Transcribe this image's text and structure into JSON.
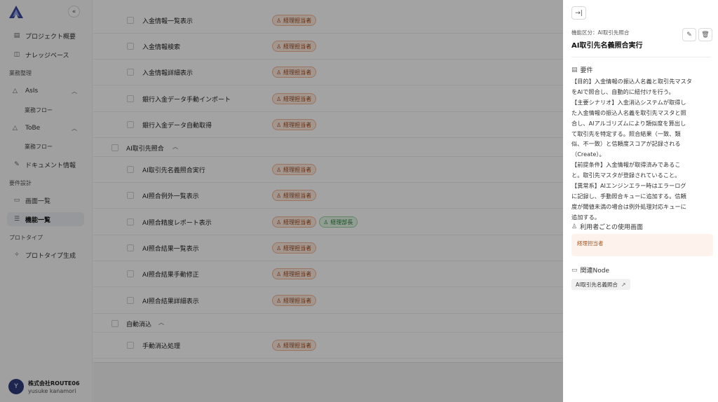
{
  "sidebar": {
    "collapse_icon": "double-chevron-left-icon",
    "items": {
      "project_overview": "プロジェクト概要",
      "knowledge_base": "ナレッジベース",
      "section_business": "業務整理",
      "asis": "AsIs",
      "asis_flow": "業務フロー",
      "tobe": "ToBe",
      "tobe_flow": "業務フロー",
      "documents": "ドキュメント情報",
      "section_requirements": "要件設計",
      "screen_list": "画面一覧",
      "function_list": "機能一覧",
      "section_prototype": "プロトタイプ",
      "prototype_gen": "プロトタイプ生成"
    },
    "user": {
      "initial": "Y",
      "org": "株式会社ROUTE06",
      "name": "yusuke kanamori"
    }
  },
  "main": {
    "rows": [
      {
        "label": "入金情報一覧表示",
        "tags": [
          "経理担当者"
        ]
      },
      {
        "label": "入金情報検索",
        "tags": [
          "経理担当者"
        ]
      },
      {
        "label": "入金情報詳細表示",
        "tags": [
          "経理担当者"
        ]
      },
      {
        "label": "銀行入金データ手動インポート",
        "tags": [
          "経理担当者"
        ]
      },
      {
        "label": "銀行入金データ自動取得",
        "tags": [
          "経理担当者"
        ]
      }
    ],
    "group_ai": "AI取引先照合",
    "ai_rows": [
      {
        "label": "AI取引先名義照合実行",
        "tags": [
          "経理担当者"
        ]
      },
      {
        "label": "AI照合例外一覧表示",
        "tags": [
          "経理担当者"
        ]
      },
      {
        "label": "AI照合精度レポート表示",
        "tags": [
          "経理担当者",
          "経理部長"
        ]
      },
      {
        "label": "AI照合結果一覧表示",
        "tags": [
          "経理担当者"
        ]
      },
      {
        "label": "AI照合結果手動修正",
        "tags": [
          "経理担当者"
        ]
      },
      {
        "label": "AI照合結果詳細表示",
        "tags": [
          "経理担当者"
        ]
      }
    ],
    "group_auto": "自動消込",
    "auto_rows": [
      {
        "label": "手動消込処理",
        "tags": [
          "経理担当者"
        ]
      }
    ]
  },
  "panel": {
    "category": "機能区分：AI取引先照合",
    "title": "AI取引先名義照合実行",
    "requirements_heading": "要件",
    "requirements_lines": [
      "【目的】入金情報の振込人名義と取引先マスタ",
      "をAIで照合し、自動的に紐付けを行う。",
      "【主要シナリオ】入金消込システムが取得し",
      "た入金情報の振込人名義を取引先マスタと照",
      "合し、AIアルゴリズムにより類似度を算出し",
      "て取引先を特定する。照合結果（一致、類",
      "似、不一致）と信頼度スコアが記録される",
      "（Create）。",
      "【前提条件】入金情報が取得済みであるこ",
      "と。取引先マスタが登録されていること。",
      "【異常系】AIエンジンエラー時はエラーログ",
      "に記録し、手動照合キューに追加する。信頼",
      "度が閾値未満の場合は例外処理対応キューに",
      "追加する。"
    ],
    "users_heading": "利用者ごとの使用画面",
    "user_role": "経理担当者",
    "node_heading": "関連Node",
    "node_chip": "AI取引先名義照合"
  }
}
